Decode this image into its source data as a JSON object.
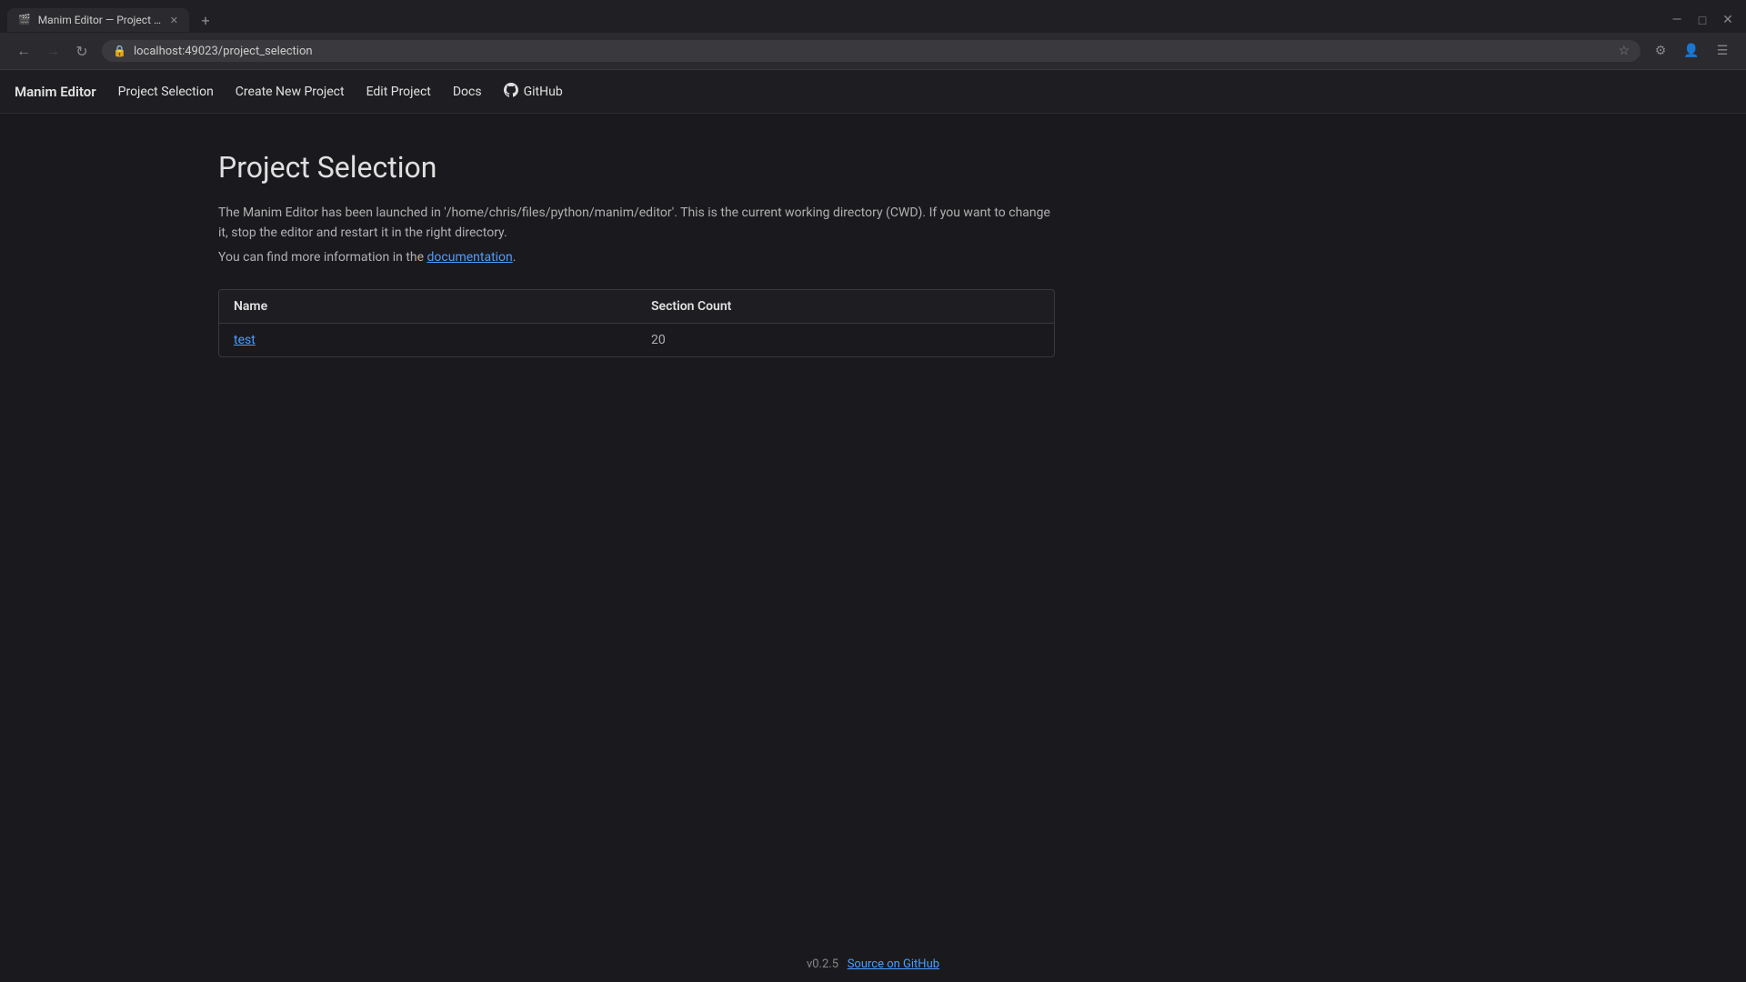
{
  "browser": {
    "tab_title": "Manim Editor — Project S...",
    "tab_favicon": "M",
    "url": "localhost:49023/project_selection",
    "new_tab_label": "+",
    "back_btn": "←",
    "forward_btn": "→",
    "reload_btn": "↻",
    "star_icon": "☆",
    "window_minimize": "—",
    "window_maximize": "□",
    "window_close": "✕"
  },
  "navbar": {
    "brand": "Manim Editor",
    "links": [
      {
        "label": "Project Selection",
        "href": "#",
        "active": true
      },
      {
        "label": "Create New Project",
        "href": "#",
        "active": false
      },
      {
        "label": "Edit Project",
        "href": "#",
        "active": false
      },
      {
        "label": "Docs",
        "href": "#",
        "active": false
      },
      {
        "label": "GitHub",
        "href": "#",
        "active": false
      }
    ]
  },
  "page": {
    "title": "Project Selection",
    "description_line1": "The Manim Editor has been launched in '/home/chris/files/python/manim/editor'. This is the current working directory (CWD). If you want to change it, stop the editor and restart it in the right directory.",
    "description_line2": "You can find more information in the ",
    "doc_link_text": "documentation",
    "doc_link_suffix": "."
  },
  "table": {
    "columns": [
      {
        "key": "name",
        "label": "Name"
      },
      {
        "key": "section_count",
        "label": "Section Count"
      }
    ],
    "rows": [
      {
        "name": "test",
        "section_count": "20",
        "href": "#"
      }
    ]
  },
  "footer": {
    "version": "v0.2.5",
    "source_link_text": "Source on GitHub",
    "source_link_href": "#"
  }
}
